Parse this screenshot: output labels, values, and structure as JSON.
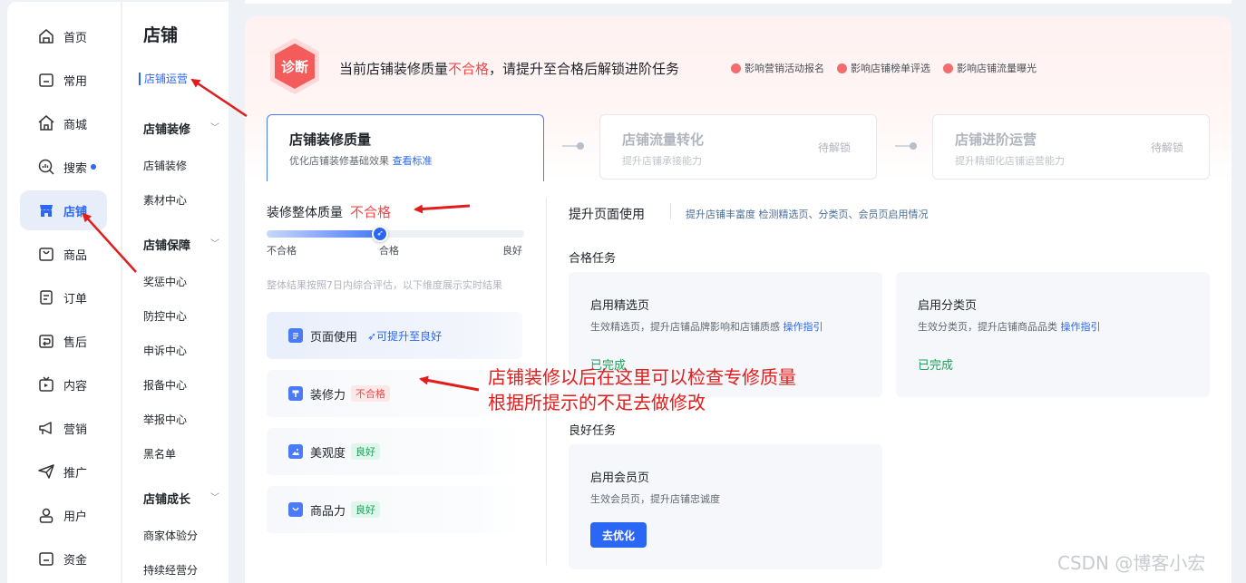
{
  "nav_primary": [
    {
      "label": "首页",
      "icon": "home-icon"
    },
    {
      "label": "常用",
      "icon": "folder-icon"
    },
    {
      "label": "商城",
      "icon": "house-icon"
    },
    {
      "label": "搜索",
      "icon": "search-chart-icon"
    },
    {
      "label": "店铺",
      "icon": "store-icon",
      "active": true
    },
    {
      "label": "商品",
      "icon": "bag-icon"
    },
    {
      "label": "订单",
      "icon": "order-icon"
    },
    {
      "label": "售后",
      "icon": "refund-icon"
    },
    {
      "label": "内容",
      "icon": "tv-icon"
    },
    {
      "label": "营销",
      "icon": "megaphone-icon"
    },
    {
      "label": "推广",
      "icon": "paper-plane-icon"
    },
    {
      "label": "用户",
      "icon": "user-icon"
    },
    {
      "label": "资金",
      "icon": "wallet-icon"
    }
  ],
  "nav_secondary": {
    "title": "店铺",
    "active_item": "店铺运营",
    "groups": [
      {
        "title": "店铺装修",
        "items": [
          "店铺装修",
          "素材中心"
        ]
      },
      {
        "title": "店铺保障",
        "items": [
          "奖惩中心",
          "防控中心",
          "申诉中心",
          "报备中心",
          "举报中心",
          "黑名单"
        ]
      },
      {
        "title": "店铺成长",
        "items": [
          "商家体验分",
          "持续经营分"
        ]
      }
    ]
  },
  "banner": {
    "badge": "诊断",
    "msg_prefix": "当前店铺装修质量",
    "msg_status": "不合格",
    "msg_suffix": "，请提升至合格后解锁进阶任务",
    "impacts": [
      "影响营销活动报名",
      "影响店铺榜单评选",
      "影响店铺流量曝光"
    ]
  },
  "stages": [
    {
      "title": "店铺装修质量",
      "desc": "优化店铺装修基础效果",
      "link": "查看标准",
      "status": ""
    },
    {
      "title": "店铺流量转化",
      "desc": "提升店铺承接能力",
      "link": "",
      "status": "待解锁"
    },
    {
      "title": "店铺进阶运营",
      "desc": "提升精细化店铺运营能力",
      "link": "",
      "status": "待解锁"
    }
  ],
  "quality": {
    "title": "装修整体质量",
    "status": "不合格",
    "scale": [
      "不合格",
      "合格",
      "良好"
    ],
    "level_fraction": 0.5,
    "note": "整体结果按照7日内综合评估，以下维度展示实时结果",
    "dimensions": [
      {
        "label": "页面使用",
        "tag": "可提升至良好",
        "tag_type": "up",
        "icon": "page-icon"
      },
      {
        "label": "装修力",
        "tag": "不合格",
        "tag_type": "bad",
        "icon": "brush-icon"
      },
      {
        "label": "美观度",
        "tag": "良好",
        "tag_type": "good",
        "icon": "image-icon"
      },
      {
        "label": "商品力",
        "tag": "良好",
        "tag_type": "good",
        "icon": "shopping-bag-icon"
      }
    ]
  },
  "right_panel": {
    "title": "提升页面使用",
    "subtitle": "提升店铺丰富度  检测精选页、分类页、会员页启用情况",
    "qualified_section": "合格任务",
    "good_section": "良好任务",
    "tasks": [
      {
        "title": "启用精选页",
        "desc": "生效精选页，提升店铺品牌影响和店铺质感",
        "link": "操作指引",
        "status": "已完成"
      },
      {
        "title": "启用分类页",
        "desc": "生效分类页，提升店铺商品品类",
        "link": "操作指引",
        "status": "已完成"
      },
      {
        "title": "启用会员页",
        "desc": "生效会员页，提升店铺忠诚度",
        "link": "",
        "button": "去优化"
      }
    ]
  },
  "annotation": {
    "line1": "店铺装修以后在这里可以检查专修质量",
    "line2": "根据所提示的不足去做修改",
    "color": "#e11d1d"
  },
  "watermark": "CSDN @博客小宏",
  "colors": {
    "accent": "#2b67f5",
    "danger": "#f04a4a",
    "success": "#1aa35a"
  }
}
